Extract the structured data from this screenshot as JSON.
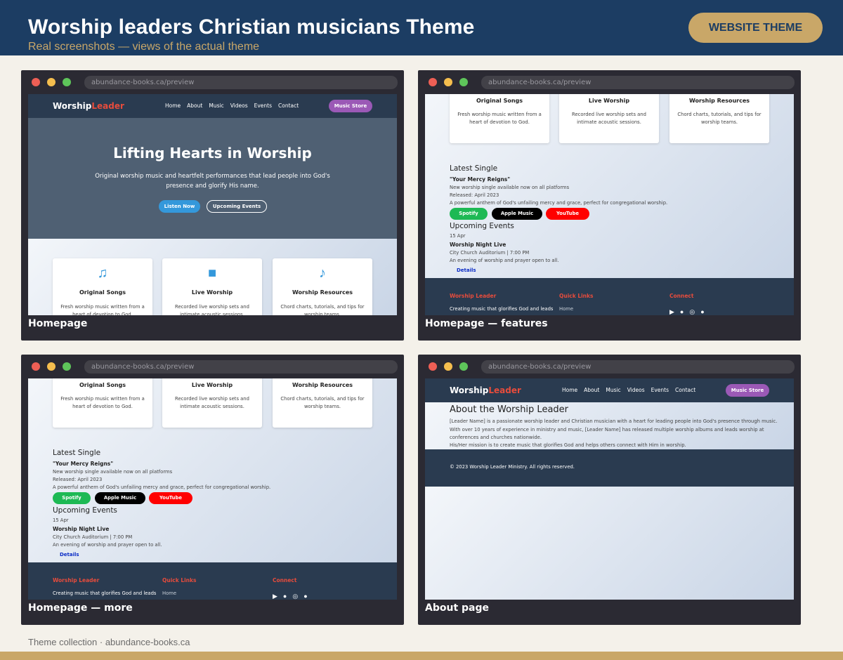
{
  "header": {
    "title": "Worship leaders Christian musicians Theme",
    "subtitle": "Real screenshots — views of the actual theme",
    "badge": "WEBSITE THEME"
  },
  "browser": {
    "url": "abundance-books.ca/preview"
  },
  "site": {
    "logo_main": "Worship",
    "logo_accent": "Leader",
    "nav": [
      "Home",
      "About",
      "Music",
      "Videos",
      "Events",
      "Contact"
    ],
    "store_button": "Music Store",
    "hero_title": "Lifting Hearts in Worship",
    "hero_text": "Original worship music and heartfelt performances that lead people into God's presence and glorify His name.",
    "listen_button": "Listen Now",
    "events_button": "Upcoming Events",
    "features": [
      {
        "icon": "music-note-icon",
        "glyph": "♫",
        "title": "Original Songs",
        "text": "Fresh worship music written from a heart of devotion to God."
      },
      {
        "icon": "video-camera-icon",
        "glyph": "■",
        "title": "Live Worship",
        "text": "Recorded live worship sets and intimate acoustic sessions."
      },
      {
        "icon": "guitar-icon",
        "glyph": "♪",
        "title": "Worship Resources",
        "text": "Chord charts, tutorials, and tips for worship teams."
      }
    ],
    "latest_single": {
      "heading": "Latest Single",
      "title": "\"Your Mercy Reigns\"",
      "line1": "New worship single available now on all platforms",
      "line2": "Released: April 2023",
      "line3": "A powerful anthem of God's unfailing mercy and grace, perfect for congregational worship.",
      "spotify": "Spotify",
      "apple": "Apple Music",
      "youtube": "YouTube"
    },
    "events": {
      "heading": "Upcoming Events",
      "date": "15 Apr",
      "name": "Worship Night Live",
      "venue": "City Church Auditorium | 7:00 PM",
      "desc": "An evening of worship and prayer open to all.",
      "details": "Details"
    },
    "footer": {
      "col1_heading": "Worship Leader",
      "col1_text": "Creating music that glorifies God and leads",
      "col2_heading": "Quick Links",
      "col2_link": "Home",
      "col3_heading": "Connect"
    },
    "about": {
      "heading": "About the Worship Leader",
      "p1": "[Leader Name] is a passionate worship leader and Christian musician with a heart for leading people into God's presence through music.",
      "p2a": "With over 10 years of experience in ministry and music, [Leader Name] has released multiple worship albums and leads worship at",
      "p2b": "conferences and churches nationwide.",
      "p3": "His/Her mission is to create music that glorifies God and helps others connect with Him in worship.",
      "copyright": "© 2023 Worship Leader Ministry. All rights reserved."
    }
  },
  "captions": [
    "Homepage",
    "Homepage — features",
    "Homepage — more",
    "About page"
  ],
  "footer_note": "Theme collection · abundance-books.ca",
  "colors": {
    "header_bg": "#1c3d63",
    "gold": "#c9a768",
    "site_nav": "#2a3b50",
    "accent_red": "#e74c3c",
    "store_purple": "#9b59b6",
    "link_blue": "#3498db"
  }
}
